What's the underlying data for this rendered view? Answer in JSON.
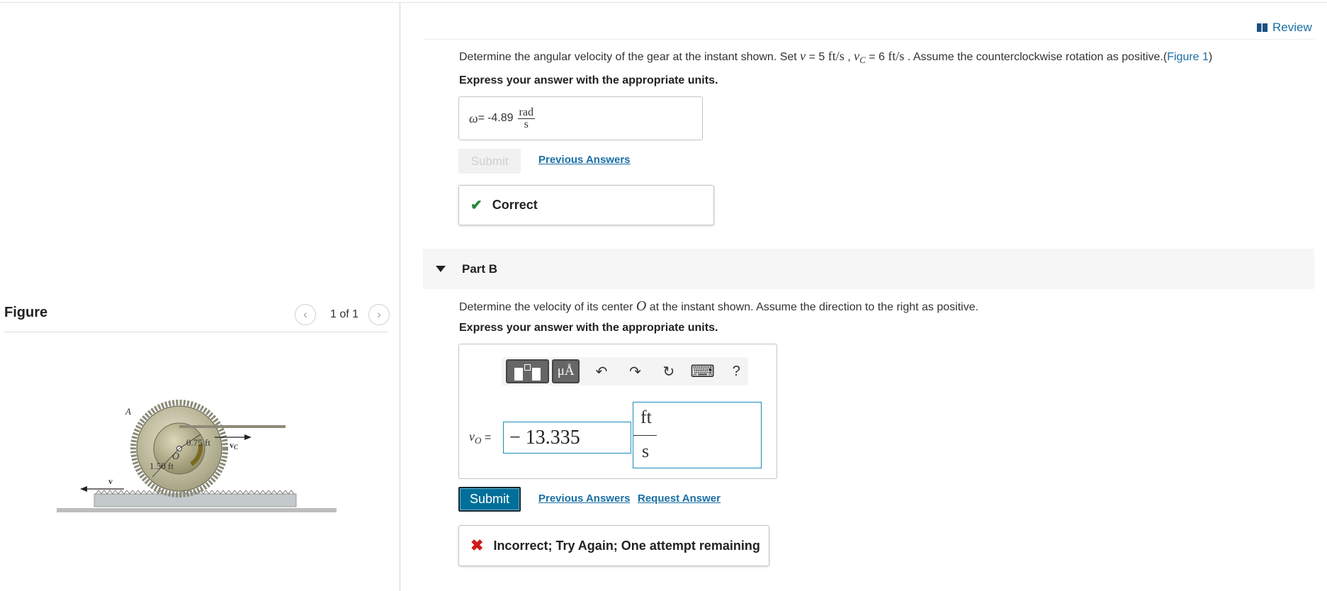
{
  "header": {
    "review_label": "Review"
  },
  "figure_panel": {
    "title": "Figure",
    "pager_text": "1 of 1",
    "labels": {
      "point_a": "A",
      "point_o": "O",
      "inner_radius": "0.75 ft",
      "outer_radius": "1.50 ft",
      "v_label": "v",
      "vc_label": "v",
      "vc_sub": "C"
    }
  },
  "part_a": {
    "question_pre": "Determine the angular velocity of the gear at the instant shown. Set ",
    "v_sym": "v",
    "v_eq": " = 5 ",
    "v_unit": "ft/s",
    "vc_sym": "v",
    "vc_sub": "C",
    "vc_eq": " = 6 ",
    "vc_unit": "ft/s",
    "question_post": " . Assume the counterclockwise rotation as positive.",
    "figure_link": "Figure 1",
    "instruction": "Express your answer with the appropriate units.",
    "answer_symbol": "ω",
    "answer_eq": " = ",
    "answer_value": "-4.89",
    "answer_unit_num": "rad",
    "answer_unit_den": "s",
    "submit_label": "Submit",
    "previous_answers": "Previous Answers",
    "feedback": "Correct"
  },
  "part_b": {
    "label": "Part B",
    "question_pre": "Determine the velocity of its center ",
    "center_sym": "O",
    "question_post": " at the instant shown. Assume the direction to the right as positive.",
    "instruction": "Express your answer with the appropriate units.",
    "toolbar": {
      "mu_label": "μÅ",
      "undo": "↶",
      "redo": "↷",
      "reset": "↻",
      "keyboard": "⌨",
      "help": "?"
    },
    "var_sym": "v",
    "var_sub": "O",
    "var_eq": " =",
    "value": "− 13.335",
    "unit_num": "ft",
    "unit_den": "s",
    "submit_label": "Submit",
    "previous_answers": "Previous Answers",
    "request_answer": "Request Answer",
    "feedback": "Incorrect; Try Again; One attempt remaining"
  },
  "colors": {
    "link": "#1a6fa3",
    "submit": "#006f99",
    "correct": "#1e8a3a",
    "incorrect": "#d0191b"
  }
}
